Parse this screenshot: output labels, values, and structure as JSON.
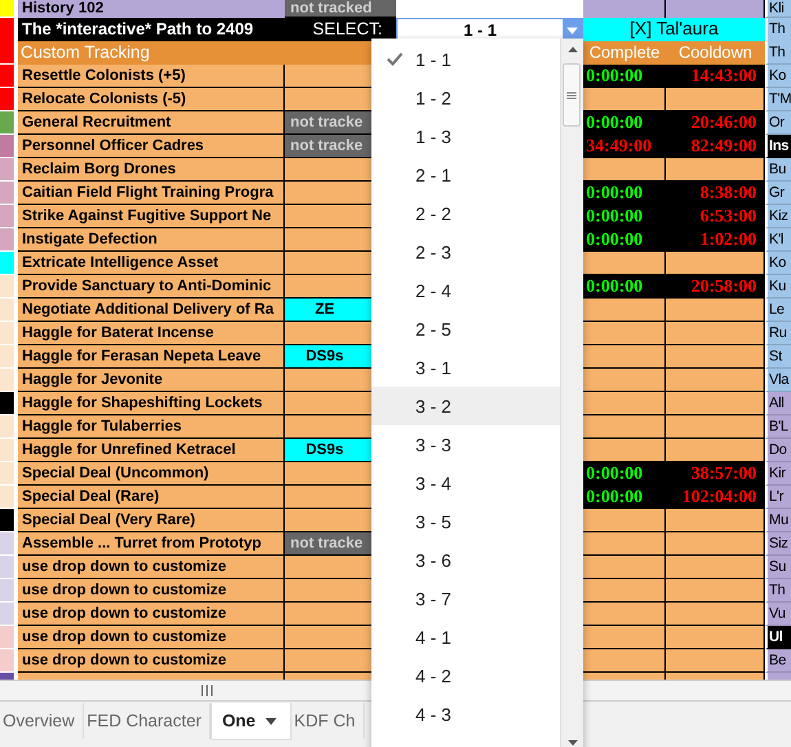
{
  "history_row": {
    "label": "History 102",
    "status": "not tracked",
    "side": "Kli",
    "color": "#ffff00"
  },
  "header_row": {
    "title": "The *interactive* Path to 2409",
    "select_label": "SELECT:",
    "select_value": "1 - 1",
    "faction": "[X] Tal'aura",
    "side": "Th",
    "color": "#ff0000"
  },
  "section": {
    "title": "Custom Tracking",
    "complete_header": "Complete",
    "cooldown_header": "Cooldown",
    "side": "Th",
    "color": "#ff0000"
  },
  "rows": [
    {
      "name": "Resettle Colonists (+5)",
      "color": "#ff0000",
      "complete": "0:00:00",
      "complete_ready": true,
      "cooldown": "14:43:00",
      "side": {
        "text": "Ko",
        "color": "#9fc5e8",
        "heading": false
      }
    },
    {
      "name": "Relocate Colonists (-5)",
      "color": "#ff0000",
      "side": {
        "text": "T'M",
        "color": "#9fc5e8",
        "heading": false
      }
    },
    {
      "name": "General Recruitment",
      "color": "#6aa84f",
      "tag": {
        "text": "not tracke",
        "kind": "untracked"
      },
      "complete": "0:00:00",
      "complete_ready": true,
      "cooldown": "20:46:00",
      "side": {
        "text": "Or",
        "color": "#9fc5e8",
        "heading": false
      }
    },
    {
      "name": "Personnel Officer Cadres",
      "color": "#c27ba0",
      "tag": {
        "text": "not tracke",
        "kind": "untracked"
      },
      "complete": "34:49:00",
      "complete_ready": false,
      "cooldown": "82:49:00",
      "side": {
        "text": "Ins",
        "color": "#000000",
        "heading": true
      }
    },
    {
      "name": "Reclaim Borg Drones",
      "color": "#d5a6bd",
      "side": {
        "text": "Bu",
        "color": "#9fc5e8",
        "heading": false
      }
    },
    {
      "name": "Caitian Field Flight Training Progra",
      "color": "#d5a6bd",
      "complete": "0:00:00",
      "complete_ready": true,
      "cooldown": "8:38:00",
      "side": {
        "text": "Gr",
        "color": "#9fc5e8",
        "heading": false
      }
    },
    {
      "name": "Strike Against Fugitive Support Ne",
      "color": "#d5a6bd",
      "complete": "0:00:00",
      "complete_ready": true,
      "cooldown": "6:53:00",
      "side": {
        "text": "Kiz",
        "color": "#9fc5e8",
        "heading": false
      }
    },
    {
      "name": "Instigate Defection",
      "color": "#d5a6bd",
      "complete": "0:00:00",
      "complete_ready": true,
      "cooldown": "1:02:00",
      "side": {
        "text": "K'l",
        "color": "#9fc5e8",
        "heading": false
      }
    },
    {
      "name": "Extricate Intelligence Asset",
      "color": "#00ffff",
      "side": {
        "text": "Ko",
        "color": "#9fc5e8",
        "heading": false
      }
    },
    {
      "name": "Provide Sanctuary to Anti-Dominic",
      "color": "#fce5cd",
      "complete": "0:00:00",
      "complete_ready": true,
      "cooldown": "20:58:00",
      "side": {
        "text": "Ku",
        "color": "#9fc5e8",
        "heading": false
      }
    },
    {
      "name": "Negotiate Additional Delivery of Ra",
      "color": "#fce5cd",
      "tag": {
        "text": "ZE",
        "kind": "location"
      },
      "side": {
        "text": "Le",
        "color": "#9fc5e8",
        "heading": false
      }
    },
    {
      "name": "Haggle for Baterat Incense",
      "color": "#fce5cd",
      "side": {
        "text": "Ru",
        "color": "#9fc5e8",
        "heading": false
      }
    },
    {
      "name": "Haggle for Ferasan Nepeta Leave",
      "color": "#fce5cd",
      "tag": {
        "text": "DS9s",
        "kind": "location"
      },
      "side": {
        "text": "St",
        "color": "#9fc5e8",
        "heading": false
      }
    },
    {
      "name": "Haggle for Jevonite",
      "color": "#fce5cd",
      "side": {
        "text": "Vla",
        "color": "#9fc5e8",
        "heading": false
      }
    },
    {
      "name": "Haggle for Shapeshifting Lockets",
      "color": "#000000",
      "side": {
        "text": "All",
        "color": "#b4a7d6",
        "heading": false
      }
    },
    {
      "name": "Haggle for Tulaberries",
      "color": "#fce5cd",
      "side": {
        "text": "B'L",
        "color": "#b4a7d6",
        "heading": false
      }
    },
    {
      "name": "Haggle for Unrefined Ketracel",
      "color": "#fce5cd",
      "tag": {
        "text": "DS9s",
        "kind": "location"
      },
      "side": {
        "text": "Do",
        "color": "#b4a7d6",
        "heading": false
      }
    },
    {
      "name": "Special Deal (Uncommon)",
      "color": "#fce5cd",
      "complete": "0:00:00",
      "complete_ready": true,
      "cooldown": "38:57:00",
      "side": {
        "text": "Kir",
        "color": "#b4a7d6",
        "heading": false
      }
    },
    {
      "name": "Special Deal (Rare)",
      "color": "#fce5cd",
      "complete": "0:00:00",
      "complete_ready": true,
      "cooldown": "102:04:00",
      "side": {
        "text": "L'r",
        "color": "#b4a7d6",
        "heading": false
      }
    },
    {
      "name": "Special Deal (Very Rare)",
      "color": "#000000",
      "side": {
        "text": "Mu",
        "color": "#b4a7d6",
        "heading": false
      }
    },
    {
      "name": "Assemble ... Turret from Prototyp",
      "color": "#d9d2e9",
      "tag": {
        "text": "not tracke",
        "kind": "untracked"
      },
      "side": {
        "text": "Siz",
        "color": "#b4a7d6",
        "heading": false
      }
    },
    {
      "name": "use drop down to customize",
      "color": "#d9d2e9",
      "side": {
        "text": "Su",
        "color": "#b4a7d6",
        "heading": false
      }
    },
    {
      "name": "use drop down to customize",
      "color": "#d9d2e9",
      "side": {
        "text": "Th",
        "color": "#b4a7d6",
        "heading": false
      }
    },
    {
      "name": "use drop down to customize",
      "color": "#d9d2e9",
      "side": {
        "text": "Vu",
        "color": "#b4a7d6",
        "heading": false
      }
    },
    {
      "name": "use drop down to customize",
      "color": "#f4cccc",
      "side": {
        "text": "Ul",
        "color": "#000000",
        "heading": true
      }
    },
    {
      "name": "use drop down to customize",
      "color": "#f4cccc",
      "side": {
        "text": "Be",
        "color": "#b4a7d6",
        "heading": false
      }
    }
  ],
  "dropdown": {
    "options": [
      {
        "label": "1 - 1",
        "selected": true,
        "highlighted": false
      },
      {
        "label": "1 - 2",
        "selected": false,
        "highlighted": false
      },
      {
        "label": "1 - 3",
        "selected": false,
        "highlighted": false
      },
      {
        "label": "2 - 1",
        "selected": false,
        "highlighted": false
      },
      {
        "label": "2 - 2",
        "selected": false,
        "highlighted": false
      },
      {
        "label": "2 - 3",
        "selected": false,
        "highlighted": false
      },
      {
        "label": "2 - 4",
        "selected": false,
        "highlighted": false
      },
      {
        "label": "2 - 5",
        "selected": false,
        "highlighted": false
      },
      {
        "label": "3 - 1",
        "selected": false,
        "highlighted": false
      },
      {
        "label": "3 - 2",
        "selected": false,
        "highlighted": true
      },
      {
        "label": "3 - 3",
        "selected": false,
        "highlighted": false
      },
      {
        "label": "3 - 4",
        "selected": false,
        "highlighted": false
      },
      {
        "label": "3 - 5",
        "selected": false,
        "highlighted": false
      },
      {
        "label": "3 - 6",
        "selected": false,
        "highlighted": false
      },
      {
        "label": "3 - 7",
        "selected": false,
        "highlighted": false
      },
      {
        "label": "4 - 1",
        "selected": false,
        "highlighted": false
      },
      {
        "label": "4 - 2",
        "selected": false,
        "highlighted": false
      },
      {
        "label": "4 - 3",
        "selected": false,
        "highlighted": false
      }
    ]
  },
  "sheet_tabs": [
    {
      "label": "Overview",
      "selected": false
    },
    {
      "label": "FED Character",
      "selected": false
    },
    {
      "label": "One",
      "selected": true
    },
    {
      "label": "KDF Ch",
      "selected": false
    }
  ]
}
